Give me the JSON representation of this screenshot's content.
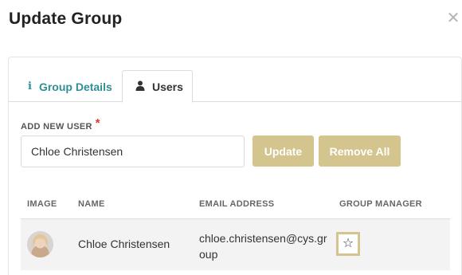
{
  "modal": {
    "title": "Update Group",
    "close_icon": "close-icon"
  },
  "tabs": [
    {
      "label": "Group Details",
      "icon": "info-icon",
      "active": false
    },
    {
      "label": "Users",
      "icon": "user-icon",
      "active": true
    }
  ],
  "add_user": {
    "label": "ADD NEW USER",
    "required_mark": "*",
    "value": "Chloe Christensen"
  },
  "buttons": {
    "update": "Update",
    "remove_all": "Remove All"
  },
  "table": {
    "headers": [
      "IMAGE",
      "NAME",
      "EMAIL ADDRESS",
      "GROUP MANAGER"
    ],
    "rows": [
      {
        "avatar": "user-avatar",
        "name": "Chloe Christensen",
        "email": "chloe.christensen@cys.group",
        "group_manager": false
      }
    ]
  },
  "colors": {
    "accent_gold": "#d4c48e",
    "tab_teal": "#2f8f95",
    "required_red": "#e53935"
  }
}
